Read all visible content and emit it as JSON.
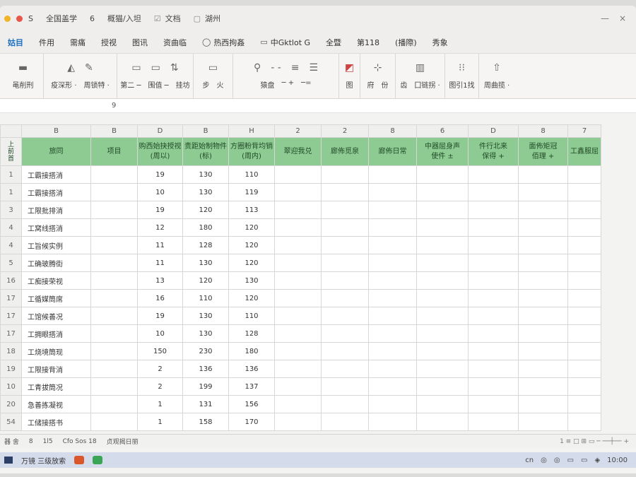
{
  "titlebar": {
    "items": [
      "S",
      "全国盖学",
      "6",
      "概猫/入坦",
      "文档",
      "湖州"
    ],
    "controls": [
      "—",
      "×"
    ]
  },
  "tabs": [
    {
      "label": "姑目",
      "active": true
    },
    {
      "label": "件用"
    },
    {
      "label": "需痛"
    },
    {
      "label": "授视"
    },
    {
      "label": "图讯"
    },
    {
      "label": "资曲临"
    },
    {
      "label": "热西拘姦",
      "icon": "chat-icon"
    },
    {
      "label": "中Gktlot G",
      "icon": "window-icon"
    },
    {
      "label": "全暨"
    },
    {
      "label": "第118"
    },
    {
      "label": "(播際)"
    },
    {
      "label": "秀象"
    }
  ],
  "ribbon": {
    "groups": [
      {
        "labels": [
          "黾削刑"
        ]
      },
      {
        "labels": [
          "疫深形 ·",
          "周锁特 ·"
        ]
      },
      {
        "labels": [
          "第二 ─",
          "围值 ─",
          "挂坊"
        ]
      },
      {
        "labels": [
          "步",
          "火"
        ]
      },
      {
        "labels": [
          "猿盘",
          "─ +",
          "─="
        ]
      },
      {
        "labels": [
          "图"
        ]
      },
      {
        "labels": [
          "府",
          "份"
        ]
      },
      {
        "labels": [
          "齿",
          "囗链拐 ·"
        ]
      },
      {
        "labels": [
          "图引1找"
        ]
      },
      {
        "labels": [
          "周曲揽 ·"
        ]
      }
    ]
  },
  "namebar": {
    "cell": "9"
  },
  "grid": {
    "col_letters": [
      "B",
      "B",
      "D",
      "B",
      "H",
      "2",
      "2",
      "8",
      "6",
      "D",
      "8",
      "7"
    ],
    "corner": "上\n前\n首",
    "headers": [
      "旅同",
      "项目",
      "购西始抉授视\n(周以)",
      "责距始制物件\n(标)",
      "方圈粉背均销\n(周内)",
      "翠迎我兑",
      "廊佈觅泉",
      "廊佈日常",
      "中器屈身声\n使件 ±",
      "件行北来\n保得 +",
      "面佈矩冠\n佰理 +",
      "工鑫服屈"
    ],
    "rows": [
      {
        "n": "1",
        "name": "工霸接搭消",
        "d": "19",
        "e": "130",
        "f": "110"
      },
      {
        "n": "1",
        "name": "工霸接搭消",
        "d": "10",
        "e": "130",
        "f": "119"
      },
      {
        "n": "3",
        "name": "工限批排消",
        "d": "19",
        "e": "120",
        "f": "113"
      },
      {
        "n": "4",
        "name": "工窝线搭消",
        "d": "12",
        "e": "180",
        "f": "120"
      },
      {
        "n": "4",
        "name": "工旨候实例",
        "d": "11",
        "e": "128",
        "f": "120"
      },
      {
        "n": "5",
        "name": "工确玻腾街",
        "d": "11",
        "e": "130",
        "f": "120"
      },
      {
        "n": "16",
        "name": "工痴接荣视",
        "d": "13",
        "e": "120",
        "f": "130"
      },
      {
        "n": "17",
        "name": "工循媒筒席",
        "d": "16",
        "e": "110",
        "f": "120"
      },
      {
        "n": "17",
        "name": "工馆候善况",
        "d": "19",
        "e": "130",
        "f": "110"
      },
      {
        "n": "17",
        "name": "工拥眼搭消",
        "d": "10",
        "e": "130",
        "f": "128"
      },
      {
        "n": "18",
        "name": "工烧境筒现",
        "d": "150",
        "e": "230",
        "f": "180"
      },
      {
        "n": "19",
        "name": "工限接背消",
        "d": "2",
        "e": "136",
        "f": "136"
      },
      {
        "n": "10",
        "name": "工青拔筒况",
        "d": "2",
        "e": "199",
        "f": "137"
      },
      {
        "n": "20",
        "name": "急善拣凝视",
        "d": "1",
        "e": "131",
        "f": "156"
      },
      {
        "n": "54",
        "name": "工储接搭书",
        "d": "1",
        "e": "158",
        "f": "170"
      }
    ]
  },
  "status": {
    "items": [
      "器 舍",
      "8",
      "1l5",
      "Cfo Sos 18",
      "贞观揭日丽"
    ],
    "right": "1 ≡ □ ⊞ ▭ ─ ──┼── +"
  },
  "taskbar": {
    "items": [
      "万镜 三级放索"
    ],
    "right": [
      "cn",
      "◎",
      "◎",
      "▭",
      "▭",
      "◈",
      "10:00"
    ]
  },
  "colors": {
    "header_green": "#8ecb93",
    "accent_blue": "#1d6fc1"
  }
}
